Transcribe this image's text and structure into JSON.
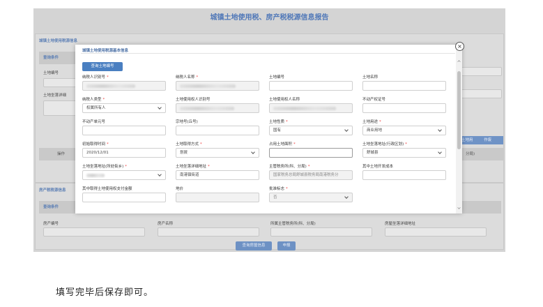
{
  "page_title": "城镇土地使用税、房产税税源信息报告",
  "background": {
    "land_section_title": "城镇土地使用税源信息",
    "query_head": "查询条件",
    "land_no_label": "土地编号",
    "land_address_label": "土地坐落详细",
    "ops_label": "操作",
    "right_strip_a": "土地用",
    "right_strip_b": "作废",
    "right_cell": "分局)",
    "house_section_title": "房产税税源信息",
    "house_query_head": "查询条件",
    "house_no_label": "房产编号",
    "house_name_label": "房产名称",
    "house_tax_office_label": "所属主管税务所(科、分局)",
    "house_address_label": "房屋坐落详细地址",
    "btn_query_house": "查询房屋信息",
    "btn_add": "申报"
  },
  "modal": {
    "title": "城镇土地使用税源基本信息",
    "query_button": "查询土地编号",
    "fields": {
      "taxpayer_id": {
        "label": "纳税人识别号",
        "required": true,
        "value": ""
      },
      "taxpayer_name": {
        "label": "纳税人名称",
        "required": true,
        "value": ""
      },
      "land_no": {
        "label": "土地编号",
        "required": false,
        "value": ""
      },
      "land_name": {
        "label": "土地名称",
        "required": false,
        "value": ""
      },
      "taxpayer_type": {
        "label": "纳税人类型",
        "required": true,
        "value": "权属所有人"
      },
      "user_id": {
        "label": "土地使用权人识别号",
        "required": false,
        "value": ""
      },
      "user_name": {
        "label": "土地使用权人名称",
        "required": false,
        "value": ""
      },
      "property_cert": {
        "label": "不动产权证号",
        "required": false,
        "value": ""
      },
      "property_unit": {
        "label": "不动产单元号",
        "required": false,
        "value": ""
      },
      "parcel_no": {
        "label": "宗地号(丘号)",
        "required": false,
        "value": ""
      },
      "land_nature": {
        "label": "土地性质",
        "required": true,
        "value": "国有"
      },
      "land_use": {
        "label": "土地用途",
        "required": true,
        "value": "商业用地"
      },
      "acquire_time": {
        "label": "初始取得时间",
        "required": true,
        "value": "2020/12/01"
      },
      "acquire_method": {
        "label": "土地取得方式",
        "required": true,
        "value": "划拨"
      },
      "land_area": {
        "label": "占用土地面积",
        "required": true,
        "value": ""
      },
      "land_location": {
        "label": "土地坐落地址(行政区划)",
        "required": true,
        "value": "舒城县"
      },
      "street": {
        "label": "土地坐落地址(所处街乡)",
        "required": true,
        "value": ""
      },
      "address_detail": {
        "label": "土地坐落详细地址",
        "required": true,
        "value": "南港镇街道"
      },
      "tax_office": {
        "label": "主管税务所(科、分局)",
        "required": true,
        "value": "国家税务总局舒城县税务局南港税务分"
      },
      "dev_cost": {
        "label": "其中土地开发成本",
        "required": false,
        "value": ""
      },
      "pay_amount": {
        "label": "其中取得土地使用权支付金额",
        "required": false,
        "value": ""
      },
      "land_price": {
        "label": "地价",
        "required": false,
        "value": ""
      },
      "approved": {
        "label": "批准标志",
        "required": true,
        "value": "否"
      }
    },
    "close_glyph": "×"
  },
  "caption": "填写完毕后保存即可。"
}
